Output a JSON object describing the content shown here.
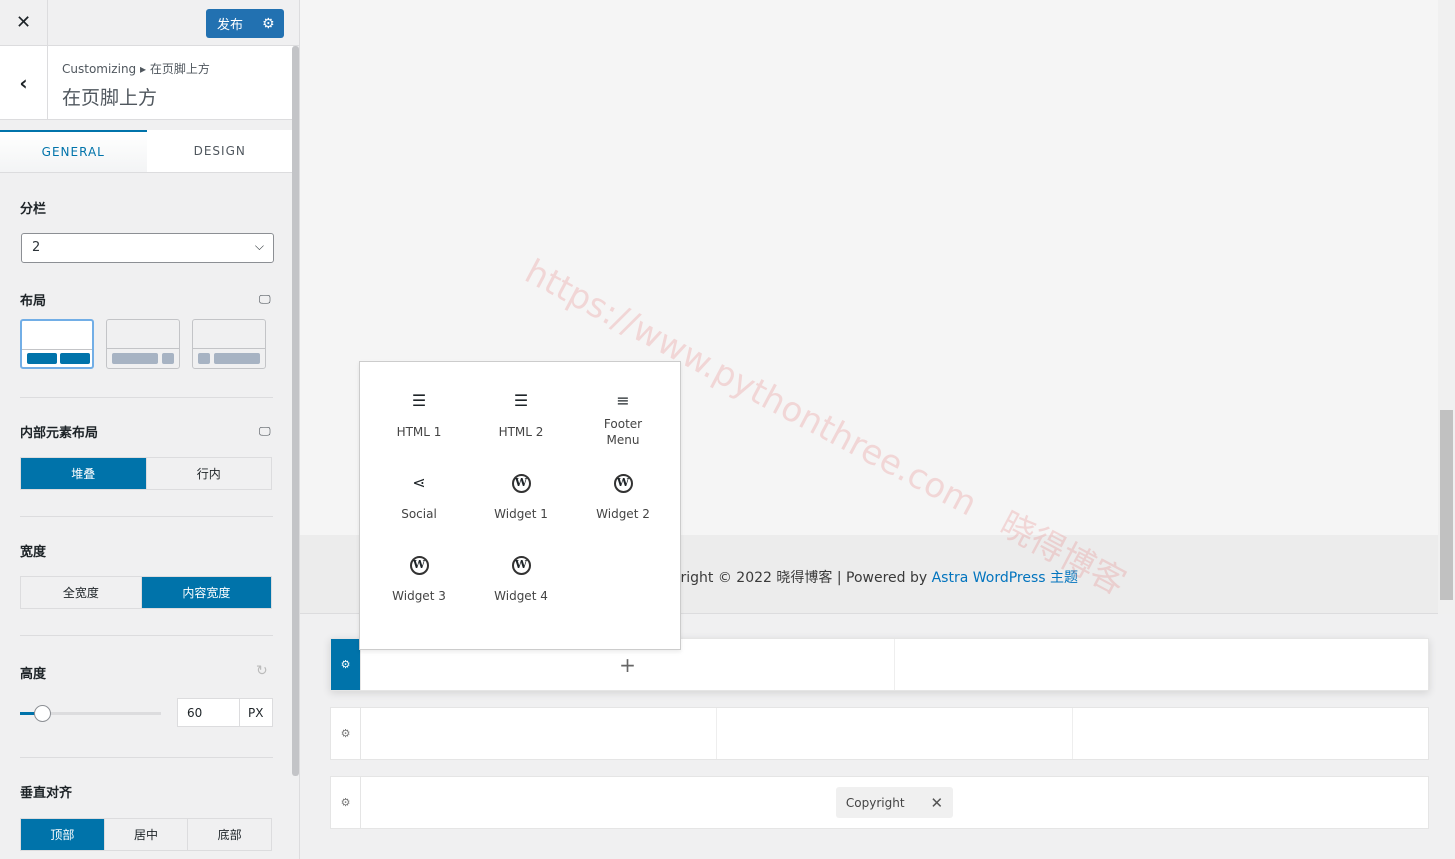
{
  "sidebar": {
    "close_icon": "close-icon",
    "publish_label": "发布",
    "settings_icon": "gear-icon",
    "breadcrumb": "Customizing ▸ 在页脚上方",
    "title": "在页脚上方",
    "tabs": [
      {
        "label": "GENERAL",
        "active": true
      },
      {
        "label": "DESIGN",
        "active": false
      }
    ],
    "columns": {
      "label": "分栏",
      "value": "2"
    },
    "layout": {
      "label": "布局",
      "selected": 0
    },
    "inner_layout": {
      "label": "内部元素布局",
      "options": [
        "堆叠",
        "行内"
      ],
      "selected": "堆叠"
    },
    "width": {
      "label": "宽度",
      "options": [
        "全宽度",
        "内容宽度"
      ],
      "selected": "内容宽度"
    },
    "height": {
      "label": "高度",
      "value": "60",
      "unit": "PX"
    },
    "valign": {
      "label": "垂直对齐",
      "options": [
        "顶部",
        "居中",
        "底部"
      ],
      "selected": "顶部"
    }
  },
  "preview": {
    "footer_text": "Copyright © 2022 晓得博客 | Powered by ",
    "footer_link": "Astra WordPress 主题",
    "watermark": "https://www.pythonthree.com 晓得博客"
  },
  "popup": {
    "items": [
      {
        "label": "HTML 1",
        "icon": "text-align-icon"
      },
      {
        "label": "HTML 2",
        "icon": "text-align-icon"
      },
      {
        "label": "Footer\nMenu",
        "icon": "menu-icon"
      },
      {
        "label": "Social",
        "icon": "share-icon"
      },
      {
        "label": "Widget 1",
        "icon": "wordpress-icon"
      },
      {
        "label": "Widget 2",
        "icon": "wordpress-icon"
      },
      {
        "label": "Widget 3",
        "icon": "wordpress-icon"
      },
      {
        "label": "Widget 4",
        "icon": "wordpress-icon"
      }
    ]
  },
  "builder": {
    "copyright_chip": "Copyright"
  },
  "colors": {
    "accent": "#0073aa",
    "publish": "#2271b1"
  }
}
